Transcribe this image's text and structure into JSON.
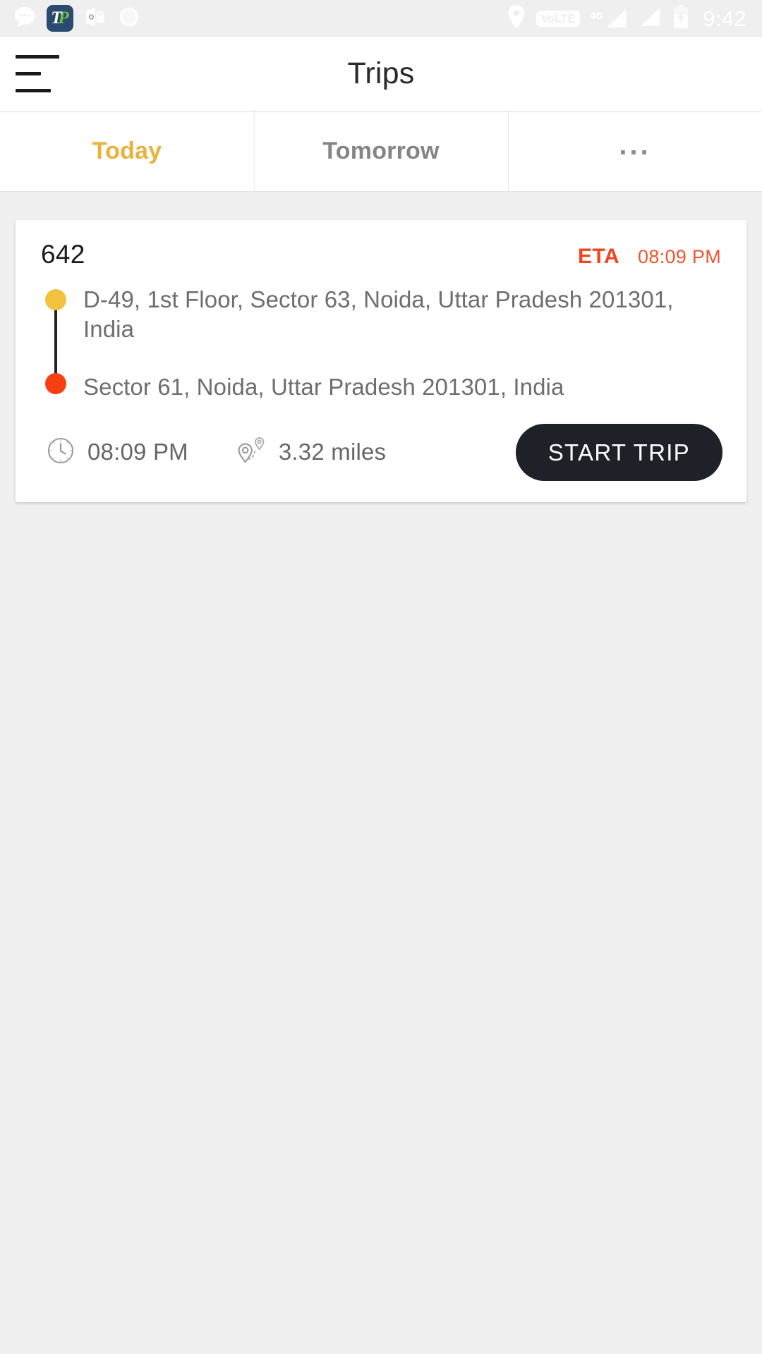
{
  "status_bar": {
    "icons_left": [
      "chat-bubble-icon",
      "tp-app-icon",
      "outlook-icon",
      "circle-icon"
    ],
    "app_icon_t": "T",
    "app_icon_p": "P",
    "volte_label": "VoLTE",
    "network_generation": "4G",
    "icons_right": [
      "location-pin-icon",
      "volte-icon",
      "signal-icon",
      "signal-icon",
      "battery-charging-icon"
    ],
    "time": "9:42"
  },
  "app_bar": {
    "menu_icon": "hamburger-menu-icon",
    "title": "Trips"
  },
  "tabs": [
    {
      "label": "Today",
      "active": true
    },
    {
      "label": "Tomorrow",
      "active": false
    },
    {
      "label": "...",
      "active": false
    }
  ],
  "trip": {
    "number": "642",
    "eta_label": "ETA",
    "eta_time": "08:09 PM",
    "origin_address": "D-49, 1st Floor, Sector 63, Noida, Uttar Pradesh 201301, India",
    "destination_address": "Sector 61, Noida, Uttar Pradesh 201301, India",
    "time_value": "08:09 PM",
    "distance_value": "3.32 miles",
    "start_button": "START TRIP"
  },
  "colors": {
    "accent_active_tab": "#E9B23C",
    "eta_label": "#F4441E",
    "eta_time": "#F0552F",
    "origin_dot": "#F1C33F",
    "destination_dot": "#F73F12",
    "start_button_bg": "#1E2127",
    "page_background": "#F0F0F0"
  }
}
